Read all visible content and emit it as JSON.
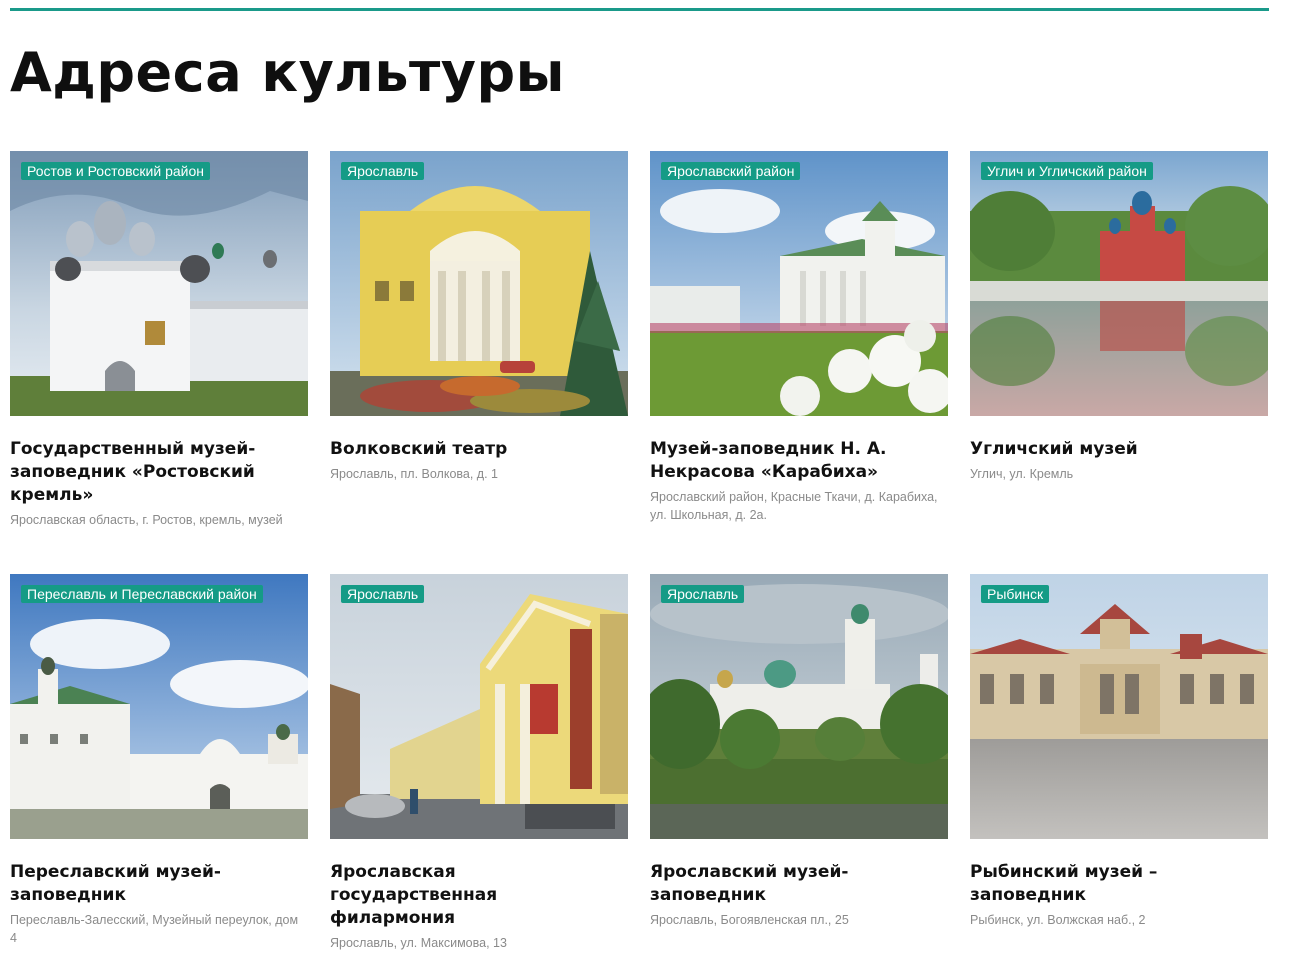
{
  "page": {
    "title": "Адреса культуры"
  },
  "colors": {
    "accent": "#159b86",
    "rule": "#1a9a8a",
    "title": "#111111",
    "address": "#8a8a8a"
  },
  "cards": [
    {
      "tag": "Ростов и Ростовский район",
      "title": "Государственный музей-заповедник «Ростовский кремль»",
      "address": "Ярославская область, г. Ростов, кремль, музей",
      "image": "rostov-kremlin-photo"
    },
    {
      "tag": "Ярославль",
      "title": "Волковский театр",
      "address": "Ярославль, пл. Волкова, д. 1",
      "image": "volkov-theatre-photo"
    },
    {
      "tag": "Ярославский район",
      "title": "Музей-заповедник Н. А. Некрасова «Карабиха»",
      "address": "Ярославский район, Красные Ткачи, д. Карабиха, ул. Школьная, д. 2а.",
      "image": "karabikha-estate-photo"
    },
    {
      "tag": "Углич и Угличский район",
      "title": "Угличский музей",
      "address": "Углич, ул. Кремль",
      "image": "uglich-church-photo"
    },
    {
      "tag": "Переславль и Переславский район",
      "title": "Переславский музей-заповедник",
      "address": "Переславль-Залесский, Музейный переулок, дом 4",
      "image": "pereslavl-monastery-photo"
    },
    {
      "tag": "Ярославль",
      "title": "Ярославская государственная филармония",
      "address": "Ярославль, ул. Максимова, 13",
      "image": "philharmonic-street-photo"
    },
    {
      "tag": "Ярославль",
      "title": "Ярославский музей-заповедник",
      "address": "Ярославль, Богоявленская пл., 25",
      "image": "yaroslavl-monastery-photo"
    },
    {
      "tag": "Рыбинск",
      "title": "Рыбинский музей – заповедник",
      "address": "Рыбинск, ул. Волжская наб., 2",
      "image": "rybinsk-exchange-photo"
    }
  ]
}
